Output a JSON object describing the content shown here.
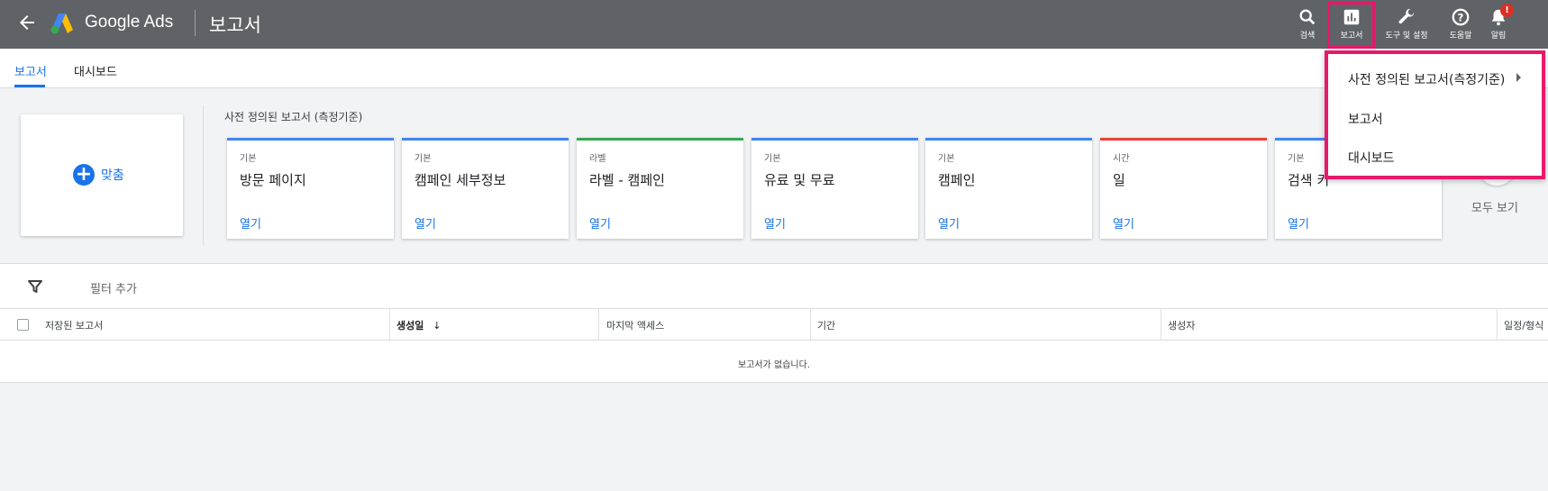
{
  "header": {
    "brand": "Google Ads",
    "page_title": "보고서",
    "buttons": [
      {
        "label": "검색",
        "icon": "search-icon"
      },
      {
        "label": "보고서",
        "icon": "reports-icon"
      },
      {
        "label": "도구 및 설정",
        "icon": "wrench-icon"
      },
      {
        "label": "도움말",
        "icon": "help-icon"
      },
      {
        "label": "알림",
        "icon": "bell-icon"
      }
    ],
    "notification_badge": "!"
  },
  "tabs": [
    {
      "label": "보고서",
      "active": true
    },
    {
      "label": "대시보드",
      "active": false
    }
  ],
  "custom_card": {
    "label": "맞춤"
  },
  "predefined": {
    "title": "사전 정의된 보고서 (측정기준)",
    "cards": [
      {
        "category": "기본",
        "name": "방문 페이지",
        "open": "열기",
        "color": "#4285f4"
      },
      {
        "category": "기본",
        "name": "캠페인 세부정보",
        "open": "열기",
        "color": "#4285f4"
      },
      {
        "category": "라벨",
        "name": "라벨 - 캠페인",
        "open": "열기",
        "color": "#34a853"
      },
      {
        "category": "기본",
        "name": "유료 및 무료",
        "open": "열기",
        "color": "#4285f4"
      },
      {
        "category": "기본",
        "name": "캠페인",
        "open": "열기",
        "color": "#4285f4"
      },
      {
        "category": "시간",
        "name": "일",
        "open": "열기",
        "color": "#ea4335"
      },
      {
        "category": "기본",
        "name": "검색 키",
        "open": "열기",
        "color": "#4285f4"
      }
    ],
    "view_all": "모두 보기"
  },
  "filter": {
    "add_label": "필터 추가"
  },
  "table": {
    "columns": [
      "저장된 보고서",
      "생성일",
      "마지막 액세스",
      "기간",
      "생성자",
      "일정/형식"
    ],
    "sort_indicator": "↓",
    "empty_message": "보고서가 없습니다."
  },
  "dropdown": {
    "items": [
      "사전 정의된 보고서(측정기준)",
      "보고서",
      "대시보드"
    ]
  }
}
